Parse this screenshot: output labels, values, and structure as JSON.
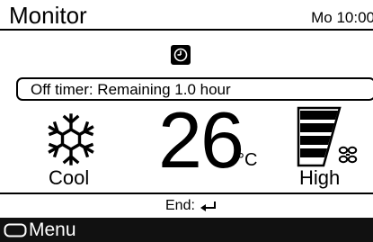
{
  "header": {
    "title": "Monitor",
    "clock": "Mo 10:00"
  },
  "timer": {
    "icon": "timer-clock-icon",
    "text": "Off timer: Remaining  1.0 hour"
  },
  "mode": {
    "icon": "snowflake-icon",
    "label": "Cool"
  },
  "temperature": {
    "value": "26",
    "unit": "°C"
  },
  "fan": {
    "icon": "fan-speed-bars-icon",
    "label": "High",
    "level_fraction": 1.0
  },
  "footer": {
    "end_label": "End:",
    "end_icon": "enter-return-icon"
  },
  "menu": {
    "icon": "menu-button-icon",
    "label": "Menu"
  },
  "colors": {
    "foreground": "#000000",
    "background": "#ffffff",
    "menu_bar": "#111111"
  }
}
